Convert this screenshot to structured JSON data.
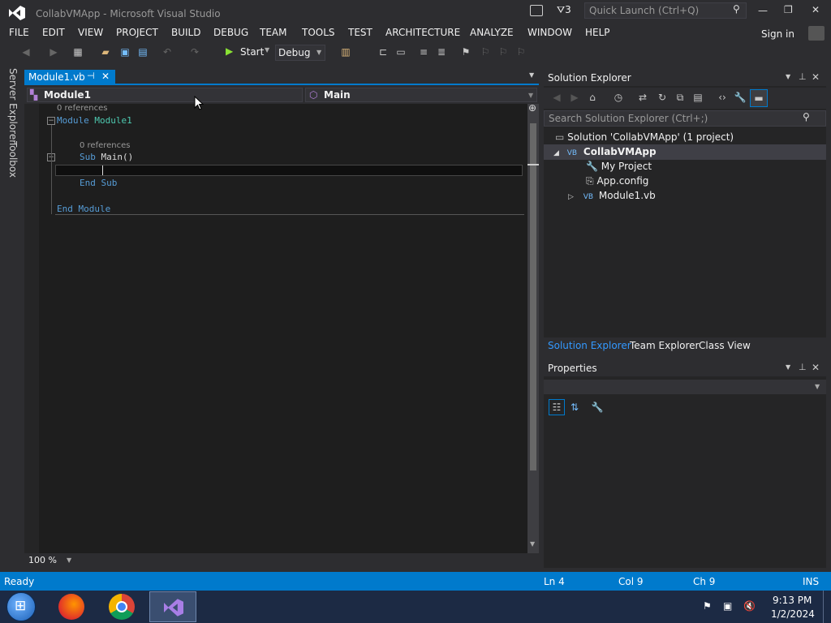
{
  "window": {
    "title": "CollabVMApp - Microsoft Visual Studio",
    "notifications_count": "3",
    "quick_launch_placeholder": "Quick Launch (Ctrl+Q)"
  },
  "menu": [
    "FILE",
    "EDIT",
    "VIEW",
    "PROJECT",
    "BUILD",
    "DEBUG",
    "TEAM",
    "TOOLS",
    "TEST",
    "ARCHITECTURE",
    "ANALYZE",
    "WINDOW",
    "HELP"
  ],
  "signin": "Sign in",
  "toolbar": {
    "start_label": "Start",
    "config_label": "Debug"
  },
  "left_strip": {
    "server_explorer": "Server Explorer",
    "toolbox": "Toolbox"
  },
  "editor": {
    "tab_label": "Module1.vb",
    "nav_left": "Module1",
    "nav_right": "Main",
    "lens1": "0 references",
    "lens2": "0 references",
    "line_module_kw": "Module",
    "line_module_name": "Module1",
    "line_sub_kw": "Sub",
    "line_sub_name": "Main()",
    "line_endsub": "End Sub",
    "line_endmodule": "End Module",
    "zoom": "100 %"
  },
  "solution_explorer": {
    "title": "Solution Explorer",
    "search_placeholder": "Search Solution Explorer (Ctrl+;)",
    "solution": "Solution 'CollabVMApp' (1 project)",
    "project": "CollabVMApp",
    "items": [
      "My Project",
      "App.config",
      "Module1.vb"
    ],
    "tabs": [
      "Solution Explorer",
      "Team Explorer",
      "Class View"
    ]
  },
  "properties": {
    "title": "Properties"
  },
  "status": {
    "state": "Ready",
    "line": "Ln 4",
    "col": "Col 9",
    "ch": "Ch 9",
    "mode": "INS"
  },
  "taskbar": {
    "time": "9:13 PM",
    "date": "1/2/2024"
  },
  "colors": {
    "accent": "#007acc",
    "editor_bg": "#1e1e1e",
    "keyword": "#569cd6",
    "type": "#4ec9b0"
  }
}
